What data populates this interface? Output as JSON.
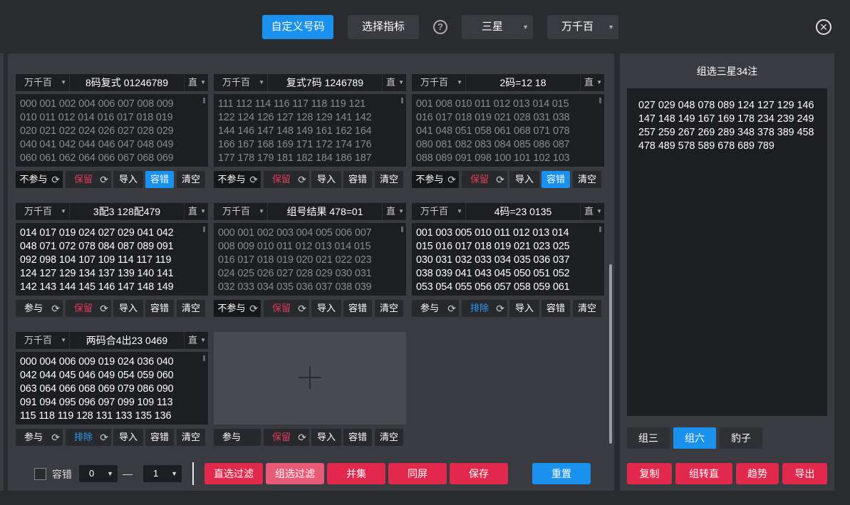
{
  "topbar": {
    "custom_code": "自定义号码",
    "select_indicator": "选择指标",
    "help": "?",
    "star_select": "三星",
    "position_select": "万千百",
    "close": "✕"
  },
  "cards": [
    {
      "mode": "万千百",
      "title": "8码复式 01246789",
      "dir": "直",
      "dim": true,
      "body": "000 001 002 004 006 007 008 009\n010 011 012 014 016 017 018 019\n020 021 022 024 026 027 028 029\n040 041 042 044 046 047 048 049\n060 061 062 064 066 067 068 069",
      "join": "不参与",
      "join_dark": true,
      "keep": "保留",
      "keep_blue": false,
      "import": "导入",
      "tolerance": "容错",
      "tolerance_on": true,
      "clear": "清空"
    },
    {
      "mode": "万千百",
      "title": "复式7码 1246789",
      "dir": "直",
      "dim": true,
      "body": "111 112 114 116 117 118 119 121\n122 124 126 127 128 129 141 142\n144 146 147 148 149 161 162 164\n166 167 168 169 171 172 174 176\n177 178 179 181 182 184 186 187",
      "join": "不参与",
      "join_dark": true,
      "keep": "保留",
      "keep_blue": false,
      "import": "导入",
      "tolerance": "容错",
      "tolerance_on": false,
      "clear": "清空"
    },
    {
      "mode": "万千百",
      "title": "2码=12 18",
      "dir": "直",
      "dim": true,
      "body": "001 008 010 011 012 013 014 015\n016 017 018 019 021 028 031 038\n041 048 051 058 061 068 071 078\n080 081 082 083 084 085 086 087\n088 089 091 098 100 101 102 103",
      "join": "不参与",
      "join_dark": true,
      "keep": "保留",
      "keep_blue": false,
      "import": "导入",
      "tolerance": "容错",
      "tolerance_on": true,
      "clear": "清空"
    },
    {
      "mode": "万千百",
      "title": "3配3 128配479",
      "dir": "直",
      "dim": false,
      "body": "014 017 019 024 027 029 041 042\n048 071 072 078 084 087 089 091\n092 098 104 107 109 114 117 119\n124 127 129 134 137 139 140 141\n142 143 144 145 146 147 148 149",
      "join": "参与",
      "join_dark": false,
      "keep": "保留",
      "keep_blue": false,
      "import": "导入",
      "tolerance": "容错",
      "tolerance_on": false,
      "clear": "清空"
    },
    {
      "mode": "万千百",
      "title": "组号结果 478=01",
      "dir": "直",
      "dim": true,
      "body": "000 001 002 003 004 005 006 007\n008 009 010 011 012 013 014 015\n016 017 018 019 020 021 022 023\n024 025 026 027 028 029 030 031\n032 033 034 035 036 037 038 039",
      "join": "不参与",
      "join_dark": true,
      "keep": "保留",
      "keep_blue": false,
      "import": "导入",
      "tolerance": "容错",
      "tolerance_on": false,
      "clear": "清空"
    },
    {
      "mode": "万千百",
      "title": "4码=23 0135",
      "dir": "直",
      "dim": false,
      "body": "001 003 005 010 011 012 013 014\n015 016 017 018 019 021 023 025\n030 031 032 033 034 035 036 037\n038 039 041 043 045 050 051 052\n053 054 055 056 057 058 059 061",
      "join": "参与",
      "join_dark": false,
      "keep": "排除",
      "keep_blue": true,
      "import": "导入",
      "tolerance": "容错",
      "tolerance_on": false,
      "clear": "清空"
    },
    {
      "mode": "万千百",
      "title": "两码合4出23 0469",
      "dir": "直",
      "dim": false,
      "body": "000 004 006 009 019 024 036 040\n042 044 045 046 049 054 059 060\n063 064 066 068 069 079 086 090\n091 094 095 096 097 099 109 113\n115 118 119 128 131 133 135 136",
      "join": "参与",
      "join_dark": false,
      "keep": "排除",
      "keep_blue": true,
      "import": "导入",
      "tolerance": "容错",
      "tolerance_on": false,
      "clear": "清空"
    }
  ],
  "add_card_controls": {
    "join": "参与",
    "keep": "保留",
    "import": "导入",
    "tolerance": "容错",
    "clear": "清空"
  },
  "bottom": {
    "tolerance_label": "容错",
    "min_value": "0",
    "dash": "—",
    "max_value": "1",
    "direct_filter": "直选过滤",
    "group_filter": "组选过滤",
    "union": "并集",
    "same_screen": "同屏",
    "save": "保存",
    "reset": "重置"
  },
  "right": {
    "title": "组选三星34注",
    "result": "027 029 048 078 089 124 127 129 146\n147 148 149 167 169 178 234 239 249\n257 259 267 269 289 348 378 389 458\n478 489 578 589 678 689 789",
    "tabs": [
      "组三",
      "组六",
      "豹子"
    ],
    "active_tab": 1,
    "copy": "复制",
    "group_to_direct": "组转直",
    "trend": "趋势",
    "export": "导出"
  },
  "colors": {
    "accent_blue": "#1a91ee",
    "accent_red": "#e2284c",
    "panel_bg": "#3a3b40",
    "box_bg": "#1d1e22"
  }
}
